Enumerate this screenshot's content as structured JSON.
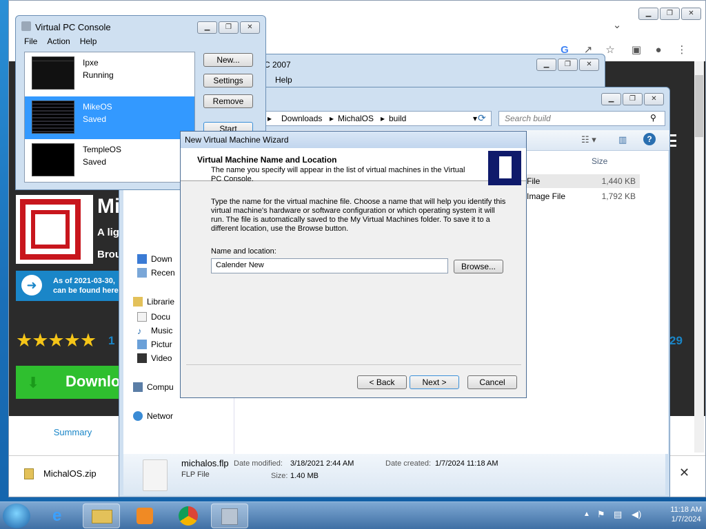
{
  "browser": {
    "hero_title": "Mi",
    "hero_sub": "A lig",
    "hero_sub2": "Brou",
    "notice_line1": "As of 2021-03-30,",
    "notice_line2": "can be found here",
    "rating_stars": "★★★★★",
    "rating_count": "1",
    "right_number": "29",
    "download_label": "Downlo",
    "summary_tab": "Summary",
    "download_file": "MichalOS.zip"
  },
  "vpc2007_window": {
    "title_fragment": "C 2007",
    "menu_help": "Help"
  },
  "explorer": {
    "breadcrumb": [
      "Downloads",
      "MichalOS",
      "build"
    ],
    "search_placeholder": "Search build",
    "column_size": "Size",
    "rows": [
      {
        "type": "File",
        "size": "1,440 KB"
      },
      {
        "type": "Image File",
        "size": "1,792 KB"
      }
    ],
    "nav": [
      "Down",
      "Recen",
      "Librarie",
      "Docu",
      "Music",
      "Pictur",
      "Video",
      "Compu",
      "Networ"
    ],
    "details": {
      "filename": "michalos.flp",
      "filetype": "FLP File",
      "date_modified_label": "Date modified:",
      "date_modified": "3/18/2021 2:44 AM",
      "date_created_label": "Date created:",
      "date_created": "1/7/2024 11:18 AM",
      "size_label": "Size:",
      "size": "1.40 MB"
    }
  },
  "console": {
    "title": "Virtual PC Console",
    "menu": [
      "File",
      "Action",
      "Help"
    ],
    "vms": [
      {
        "name": "Ipxe",
        "status": "Running"
      },
      {
        "name": "MikeOS",
        "status": "Saved"
      },
      {
        "name": "TempleOS",
        "status": "Saved"
      }
    ],
    "buttons": [
      "New...",
      "Settings",
      "Remove",
      "Start"
    ]
  },
  "wizard": {
    "window_title": "New Virtual Machine Wizard",
    "heading": "Virtual Machine Name and Location",
    "subheading": "The name you specify will appear in the list of virtual machines in the Virtual PC Console.",
    "body": "Type the name for the virtual machine file. Choose a name that will help you identify this virtual machine's hardware or software configuration or which operating system it will run. The file is automatically saved to the My Virtual Machines folder. To save it to a different location, use the Browse button.",
    "field_label": "Name and location:",
    "field_value": "Calender New",
    "browse": "Browse...",
    "back": "< Back",
    "next": "Next >",
    "cancel": "Cancel"
  },
  "taskbar": {
    "time": "11:18 AM",
    "date": "1/7/2024"
  }
}
